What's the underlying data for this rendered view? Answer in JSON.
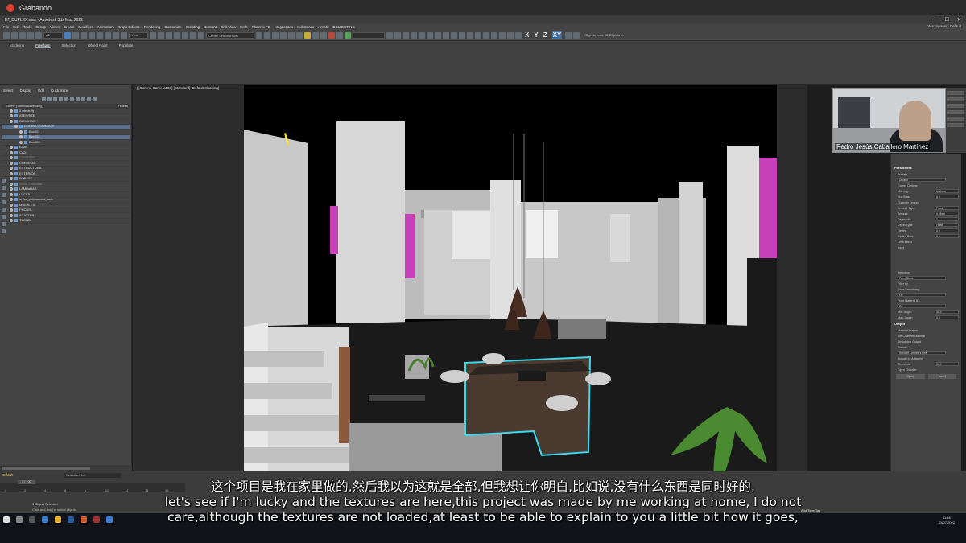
{
  "recording": {
    "label": "Grabando"
  },
  "window": {
    "title": "07_DUPLEX.max - Autodesk 3ds Max 2022",
    "workspace_label": "Workspaces:",
    "workspace_value": "Default"
  },
  "menu": [
    "File",
    "Edit",
    "Tools",
    "Group",
    "Views",
    "Create",
    "Modifiers",
    "Animation",
    "Graph Editors",
    "Rendering",
    "Customize",
    "Scripting",
    "Content",
    "Civil View",
    "Help",
    "Phoenix FD",
    "Megascans",
    "Substance",
    "Arnold",
    "DELIGHTING"
  ],
  "toolbar": {
    "filter_value": "All",
    "view_value": "View",
    "selection_set_placeholder": "Create Selection Set",
    "axes": [
      "X",
      "Y",
      "Z",
      "XY"
    ],
    "objects_info": "Objects from: 32 Objects in"
  },
  "ribbon_tabs": [
    "Modeling",
    "Freeform",
    "Selection",
    "Object Paint",
    "Populate"
  ],
  "explorer": {
    "menu": [
      "Select",
      "Display",
      "Edit",
      "Customize"
    ],
    "header": "Name (Sorted Ascending)",
    "header_right": "Frozen",
    "rows": [
      {
        "label": "0 (default)",
        "state": "normal",
        "indent": 0
      },
      {
        "label": "ATERRIZE",
        "state": "normal",
        "indent": 0
      },
      {
        "label": "BLOCKING",
        "state": "normal",
        "indent": 0
      },
      {
        "label": "COCINA COMEDOR",
        "state": "selected",
        "indent": 1
      },
      {
        "label": "Box001",
        "state": "normal",
        "indent": 2
      },
      {
        "label": "Box002",
        "state": "selected",
        "indent": 2
      },
      {
        "label": "Box003",
        "state": "normal",
        "indent": 2
      },
      {
        "label": "BIMB",
        "state": "normal",
        "indent": 0
      },
      {
        "label": "CAD",
        "state": "normal",
        "indent": 0
      },
      {
        "label": "CAMARAS",
        "state": "dim",
        "indent": 0
      },
      {
        "label": "CORTINAS",
        "state": "normal",
        "indent": 0
      },
      {
        "label": "ESTRUCTURA",
        "state": "normal",
        "indent": 0
      },
      {
        "label": "EXTERIOR",
        "state": "normal",
        "indent": 0
      },
      {
        "label": "FOREST",
        "state": "normal",
        "indent": 0
      },
      {
        "label": "Grout_Helpdata",
        "state": "dim",
        "indent": 0
      },
      {
        "label": "LAMPARAS",
        "state": "normal",
        "indent": 0
      },
      {
        "label": "LUCES",
        "state": "normal",
        "indent": 0
      },
      {
        "label": "mTex_polyremove_anis",
        "state": "normal",
        "indent": 0
      },
      {
        "label": "MUEBLES",
        "state": "normal",
        "indent": 0
      },
      {
        "label": "PHOARL",
        "state": "normal",
        "indent": 0
      },
      {
        "label": "SCATTER",
        "state": "normal",
        "indent": 0
      },
      {
        "label": "TECHO",
        "state": "normal",
        "indent": 0
      }
    ]
  },
  "viewport": {
    "label": "[+] [Corona Camera003] [Standard] [Default Shading]"
  },
  "webcam": {
    "name": "Pedro Jesús Caballero Martínez"
  },
  "command_panel": {
    "section_parameters": "Parameters",
    "presets_label": "Presets",
    "presets_value": "Default",
    "corner_options": "Corner Options",
    "params": [
      {
        "label": "Mitering:",
        "value": "Uniform"
      },
      {
        "label": "End Bias:",
        "value": "0.5"
      }
    ],
    "chamfer_options": "Chamfer Options",
    "chamfer_params": [
      {
        "label": "Amount Type:",
        "value": "Fixed"
      },
      {
        "label": "Amount:",
        "value": "0.05cm"
      },
      {
        "label": "Segments:",
        "value": "1"
      },
      {
        "label": "Depth Type:",
        "value": "Fixed"
      },
      {
        "label": "Depth:",
        "value": "0.5"
      },
      {
        "label": "Radius Bias:",
        "value": "0.0"
      }
    ],
    "limit_effect": "Limit Effect",
    "inset": "Inset",
    "selection": "Selection",
    "selection_value": "From Stack",
    "filter_by": "Filter by",
    "from_smoothing": "From Smoothing:",
    "off1": "Off",
    "from_material": "From Material ID:",
    "off2": "Off",
    "min_angle_label": "Min. Angle:",
    "min_angle_value": "30.0",
    "max_angle_label": "Max. Angle:",
    "max_angle_value": "0.0",
    "output": "Output",
    "material_output": "Material Output",
    "set_chamfer_material": "Set Chamfer Material",
    "smoothing_output": "Smoothing Output",
    "smooth": "Smooth",
    "smooth_value": "Smooth Chamfers Only",
    "smooth_adjacent": "Smooth to Adjacent",
    "threshold_label": "Threshold:",
    "threshold_value": "30.0",
    "open_chamfer": "Open Chamfer",
    "open_btn": "Open",
    "invert_btn": "Invert"
  },
  "bottom": {
    "layer": "Default",
    "selection_set": "Selection Set:",
    "frame": "0 / 100",
    "status1": "1 Object Selected",
    "status2": "Click and drag to select objects",
    "add_time_tag": "Add Time Tag",
    "ticks": [
      "0",
      "2",
      "4",
      "6",
      "8",
      "10",
      "12",
      "14",
      "16"
    ]
  },
  "taskbar": {
    "time": "11:46",
    "date": "25/07/2022"
  },
  "subtitles": [
    "这个项目是我在家里做的,然后我以为这就是全部,但我想让你明白,比如说,没有什么东西是同时好的,",
    "let's see if I'm lucky and the textures are here,this project was made by me working at home, I do not",
    "care,although the textures are not loaded,at least to be able to explain to you a little bit how it goes,"
  ],
  "colors": {
    "viewport_bg": "#000000",
    "selection_highlight": "#3ad9f0",
    "accent": "#3e6fa8",
    "plant_pink": "#c83fb4"
  }
}
